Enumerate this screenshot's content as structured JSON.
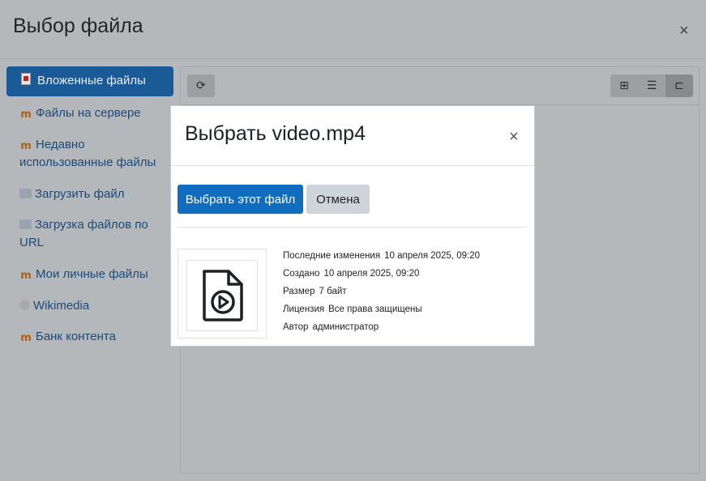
{
  "picker": {
    "title": "Выбор файла",
    "close_glyph": "×",
    "repositories": [
      {
        "label": "Вложенные файлы",
        "icon": "pdf-file-icon",
        "active": true
      },
      {
        "label": "Файлы на сервере",
        "icon": "moodle-icon"
      },
      {
        "label_lines": [
          "Недавно",
          "использованные файлы"
        ],
        "icon": "moodle-icon"
      },
      {
        "label": "Загрузить файл",
        "icon": "upload-icon"
      },
      {
        "label_lines": [
          "Загрузка файлов по",
          "URL"
        ],
        "icon": "upload-icon"
      },
      {
        "label": "Мои личные файлы",
        "icon": "moodle-icon"
      },
      {
        "label": "Wikimedia",
        "icon": "wikimedia-icon"
      },
      {
        "label": "Банк контента",
        "icon": "moodle-icon"
      }
    ],
    "toolbar": {
      "refresh_icon": "refresh-icon",
      "view_icons": [
        "grid-view-icon",
        "list-view-icon",
        "tree-view-icon"
      ],
      "active_view": "tree-view-icon"
    }
  },
  "dialog": {
    "title": "Выбрать video.mp4",
    "close_glyph": "×",
    "select_button": "Выбрать этот файл",
    "cancel_button": "Отмена",
    "preview_icon": "video-file-icon",
    "properties": [
      {
        "label": "Последние изменения",
        "value": "10 апреля 2025, 09:20"
      },
      {
        "label": "Создано",
        "value": "10 апреля 2025, 09:20"
      },
      {
        "label": "Размер",
        "value": "7 байт"
      },
      {
        "label": "Лицензия",
        "value": "Все права защищены"
      },
      {
        "label": "Автор",
        "value": "администратор"
      }
    ]
  },
  "colors": {
    "primary": "#0f6cbf",
    "backdrop": "#b4b8bb",
    "link": "#1c4a78"
  }
}
